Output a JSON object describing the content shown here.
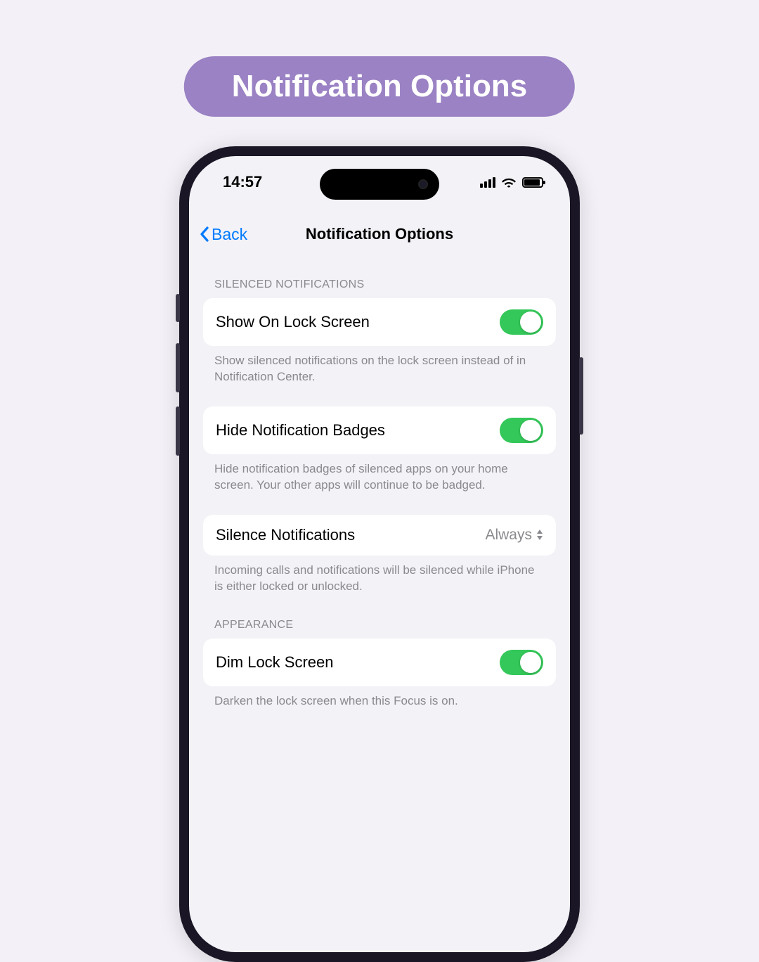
{
  "banner": {
    "title": "Notification Options"
  },
  "status": {
    "time": "14:57"
  },
  "nav": {
    "back": "Back",
    "title": "Notification Options"
  },
  "sections": {
    "silenced": {
      "header": "SILENCED NOTIFICATIONS",
      "show_lock": {
        "label": "Show On Lock Screen",
        "on": true
      },
      "show_lock_footer": "Show silenced notifications on the lock screen instead of in Notification Center.",
      "hide_badges": {
        "label": "Hide Notification Badges",
        "on": true
      },
      "hide_badges_footer": "Hide notification badges of silenced apps on your home screen. Your other apps will continue to be badged.",
      "silence": {
        "label": "Silence Notifications",
        "value": "Always"
      },
      "silence_footer": "Incoming calls and notifications will be silenced while iPhone is either locked or unlocked."
    },
    "appearance": {
      "header": "APPEARANCE",
      "dim": {
        "label": "Dim Lock Screen",
        "on": true
      },
      "dim_footer": "Darken the lock screen when this Focus is on."
    }
  }
}
